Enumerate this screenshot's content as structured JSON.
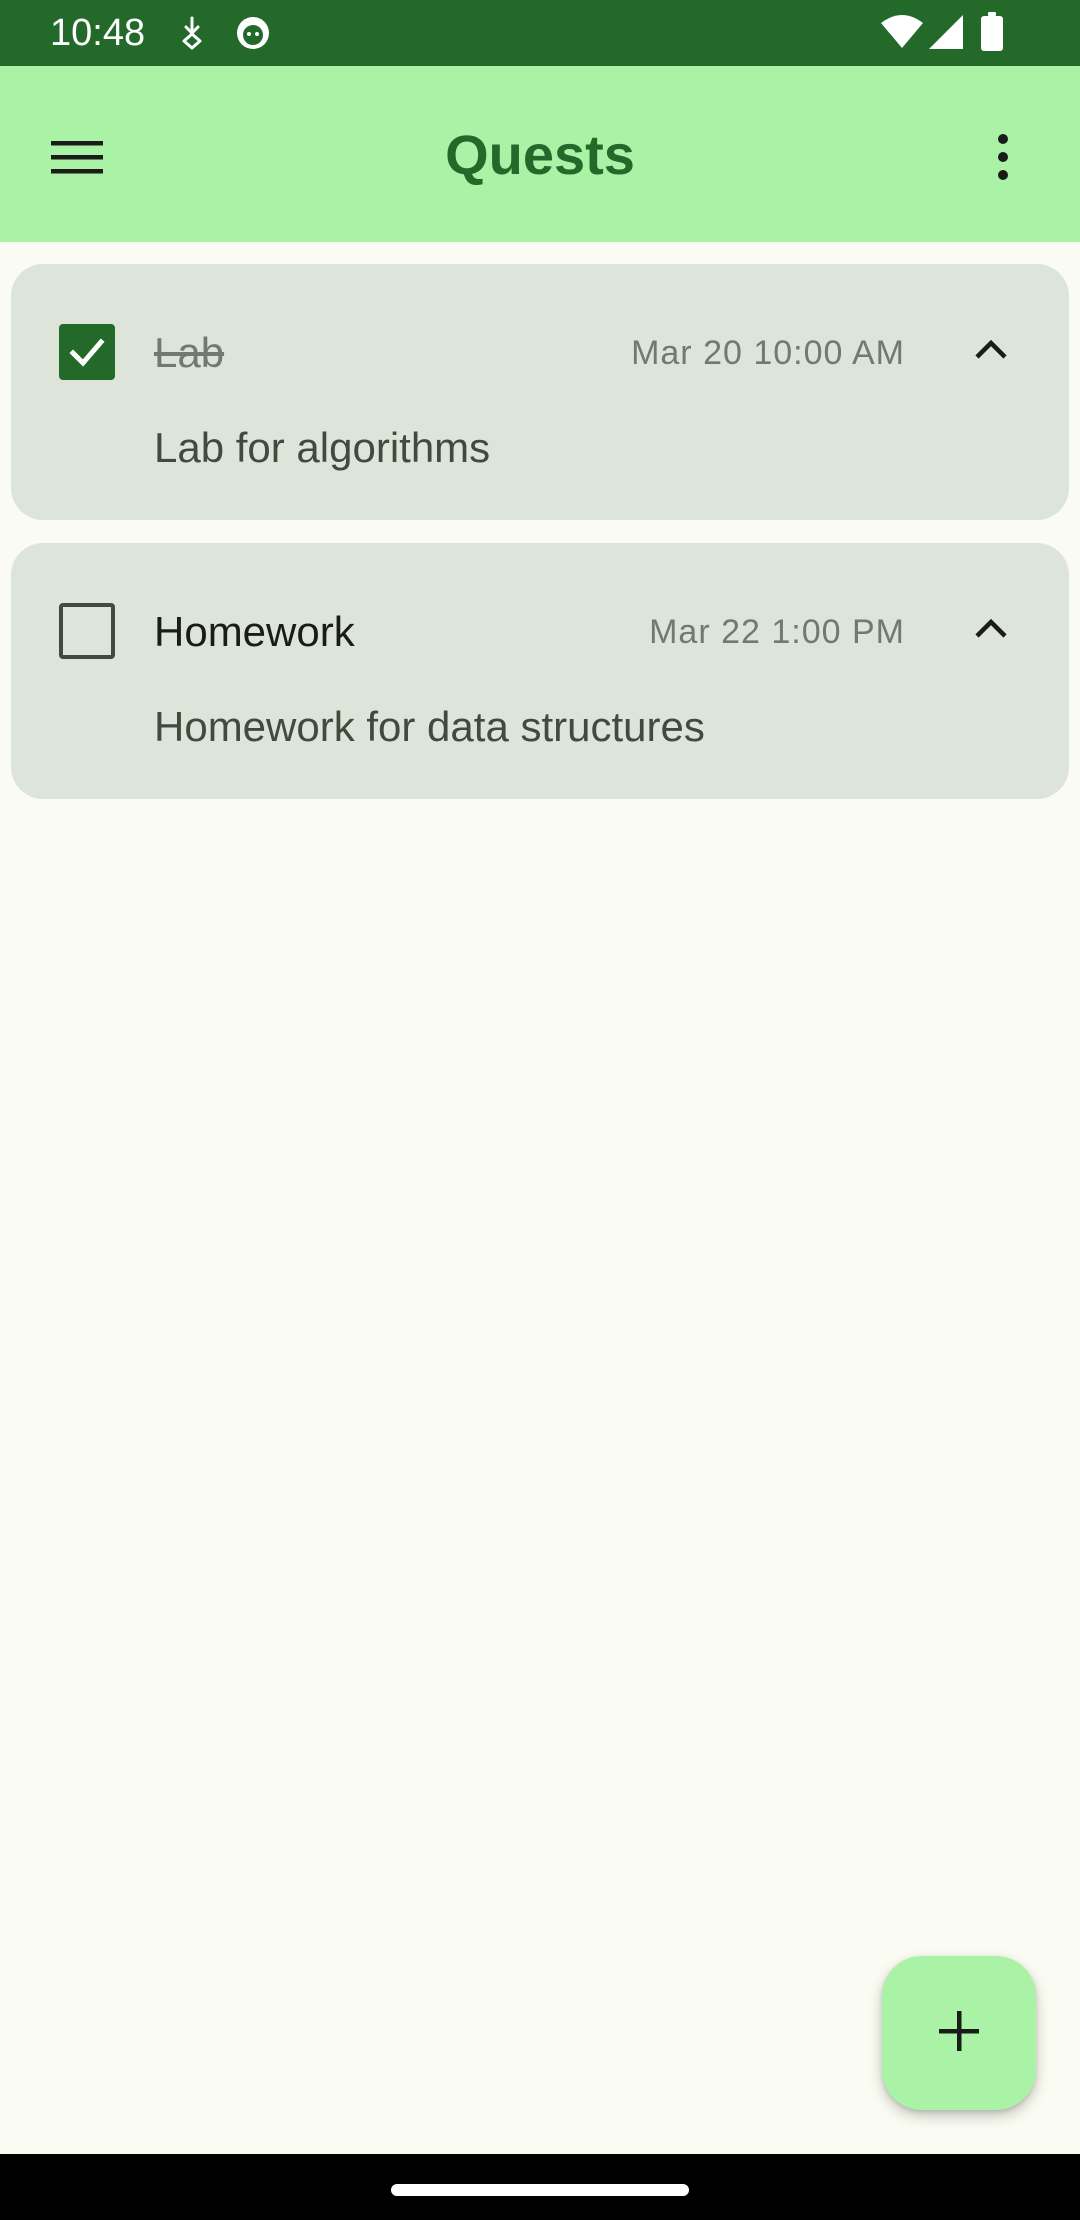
{
  "colors": {
    "status_bar": "#22692A",
    "app_bar": "#AAF3A6",
    "title": "#22692A",
    "card_background": "#DDE5DA",
    "checkbox_checked": "#22692A",
    "page_background": "#FAFCF3"
  },
  "status_bar": {
    "time": "10:48",
    "icons": [
      "download-icon",
      "cat-face-icon",
      "wifi-icon",
      "cellular-signal-icon",
      "battery-icon"
    ]
  },
  "app_bar": {
    "title": "Quests",
    "menu_icon": "hamburger-menu-icon",
    "more_icon": "more-vertical-icon"
  },
  "quests": [
    {
      "title": "Lab",
      "date": "Mar 20 10:00 AM",
      "description": "Lab for algorithms",
      "completed": true,
      "expanded": true
    },
    {
      "title": "Homework",
      "date": "Mar 22 1:00 PM",
      "description": "Homework for data structures",
      "completed": false,
      "expanded": true
    }
  ],
  "fab": {
    "icon": "plus-icon"
  }
}
